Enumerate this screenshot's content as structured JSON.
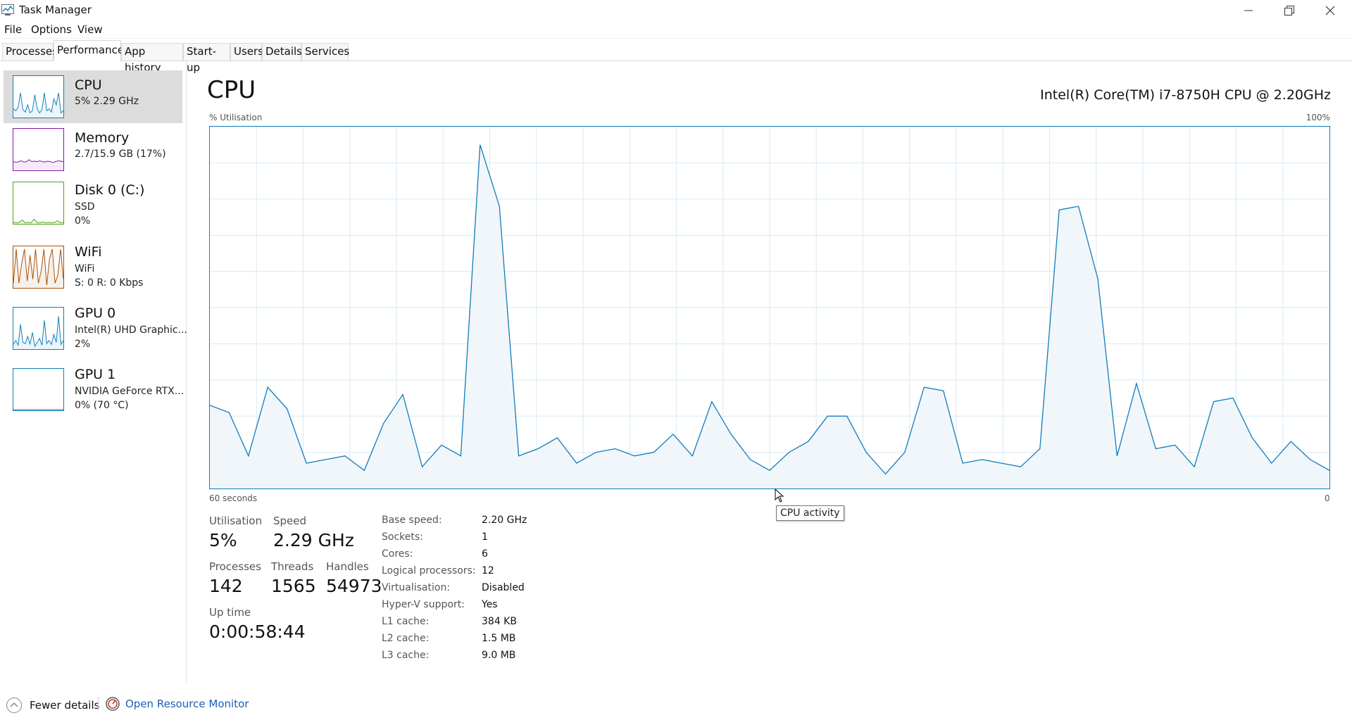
{
  "window": {
    "title": "Task Manager",
    "icon": "task-manager-icon",
    "controls": [
      "minimize-icon",
      "restore-icon",
      "close-icon"
    ]
  },
  "menu": [
    "File",
    "Options",
    "View"
  ],
  "tabs": [
    {
      "label": "Processes",
      "active": false
    },
    {
      "label": "Performance",
      "active": true
    },
    {
      "label": "App history",
      "active": false
    },
    {
      "label": "Start-up",
      "active": false
    },
    {
      "label": "Users",
      "active": false
    },
    {
      "label": "Details",
      "active": false
    },
    {
      "label": "Services",
      "active": false
    }
  ],
  "sidebar": {
    "items": [
      {
        "name": "CPU",
        "line1": "5% 2.29 GHz",
        "line2": "",
        "color": "#117dbb",
        "selected": true
      },
      {
        "name": "Memory",
        "line1": "2.7/15.9 GB (17%)",
        "line2": "",
        "color": "#8b12ae",
        "selected": false
      },
      {
        "name": "Disk 0 (C:)",
        "line1": "SSD",
        "line2": "0%",
        "color": "#4da60c",
        "selected": false
      },
      {
        "name": "WiFi",
        "line1": "WiFi",
        "line2": "S: 0 R: 0 Kbps",
        "color": "#a74f01",
        "selected": false
      },
      {
        "name": "GPU 0",
        "line1": "Intel(R) UHD Graphic...",
        "line2": "2%",
        "color": "#117dbb",
        "selected": false
      },
      {
        "name": "GPU 1",
        "line1": "NVIDIA GeForce RTX...",
        "line2": "0% (70 °C)",
        "color": "#117dbb",
        "selected": false
      }
    ]
  },
  "main": {
    "title": "CPU",
    "model": "Intel(R) Core(TM) i7-8750H CPU @ 2.20GHz",
    "graph_label_left": "% Utilisation",
    "graph_label_right": "100%",
    "time_label_left": "60 seconds",
    "time_label_right": "0",
    "tooltip": "CPU activity",
    "stats": {
      "utilisation": {
        "label": "Utilisation",
        "value": "5%"
      },
      "speed": {
        "label": "Speed",
        "value": "2.29 GHz"
      },
      "processes": {
        "label": "Processes",
        "value": "142"
      },
      "threads": {
        "label": "Threads",
        "value": "1565"
      },
      "handles": {
        "label": "Handles",
        "value": "54973"
      },
      "uptime": {
        "label": "Up time",
        "value": "0:00:58:44"
      }
    },
    "specs": [
      {
        "label": "Base speed:",
        "value": "2.20 GHz"
      },
      {
        "label": "Sockets:",
        "value": "1"
      },
      {
        "label": "Cores:",
        "value": "6"
      },
      {
        "label": "Logical processors:",
        "value": "12"
      },
      {
        "label": "Virtualisation:",
        "value": "Disabled"
      },
      {
        "label": "Hyper-V support:",
        "value": "Yes"
      },
      {
        "label": "L1 cache:",
        "value": "384 KB"
      },
      {
        "label": "L2 cache:",
        "value": "1.5 MB"
      },
      {
        "label": "L3 cache:",
        "value": "9.0 MB"
      }
    ]
  },
  "footer": {
    "fewer_details": "Fewer details",
    "open_resource_monitor": "Open Resource Monitor"
  },
  "chart_data": {
    "type": "area",
    "xlabel": "60 seconds",
    "ylabel": "% Utilisation",
    "ylim": [
      0,
      100
    ],
    "color": "#117dbb",
    "grid": true,
    "values": [
      23,
      21,
      9,
      28,
      22,
      7,
      8,
      9,
      5,
      18,
      26,
      6,
      12,
      9,
      95,
      78,
      9,
      11,
      14,
      7,
      10,
      11,
      9,
      10,
      15,
      9,
      24,
      15,
      8,
      5,
      10,
      13,
      20,
      20,
      10,
      4,
      10,
      28,
      27,
      7,
      8,
      7,
      6,
      11,
      77,
      78,
      58,
      9,
      29,
      11,
      12,
      6,
      24,
      25,
      14,
      7,
      13,
      8,
      5
    ],
    "sidebar_values": {
      "cpu": [
        20,
        15,
        25,
        60,
        18,
        12,
        30,
        10,
        15,
        55,
        20,
        10,
        18,
        60,
        15,
        20,
        12,
        45,
        30,
        60,
        10,
        15
      ],
      "memory": [
        20,
        18,
        20,
        22,
        19,
        20,
        25,
        20,
        21,
        20,
        22,
        20,
        19,
        21,
        20,
        18,
        20,
        22,
        21,
        20
      ],
      "disk": [
        2,
        1,
        2,
        8,
        1,
        2,
        1,
        10,
        2,
        1,
        3,
        1,
        2,
        1,
        2,
        6,
        1,
        2
      ],
      "wifi": [
        10,
        95,
        10,
        60,
        95,
        15,
        80,
        20,
        95,
        10,
        40,
        95,
        5,
        70,
        95,
        10,
        30,
        95,
        20
      ],
      "gpu0": [
        10,
        20,
        8,
        60,
        15,
        12,
        30,
        10,
        40,
        5,
        15,
        25,
        8,
        70,
        12,
        20,
        10,
        35,
        15,
        80,
        10,
        20
      ],
      "gpu1": [
        0,
        0,
        0,
        0,
        0,
        0,
        0,
        0,
        0,
        0
      ]
    }
  }
}
